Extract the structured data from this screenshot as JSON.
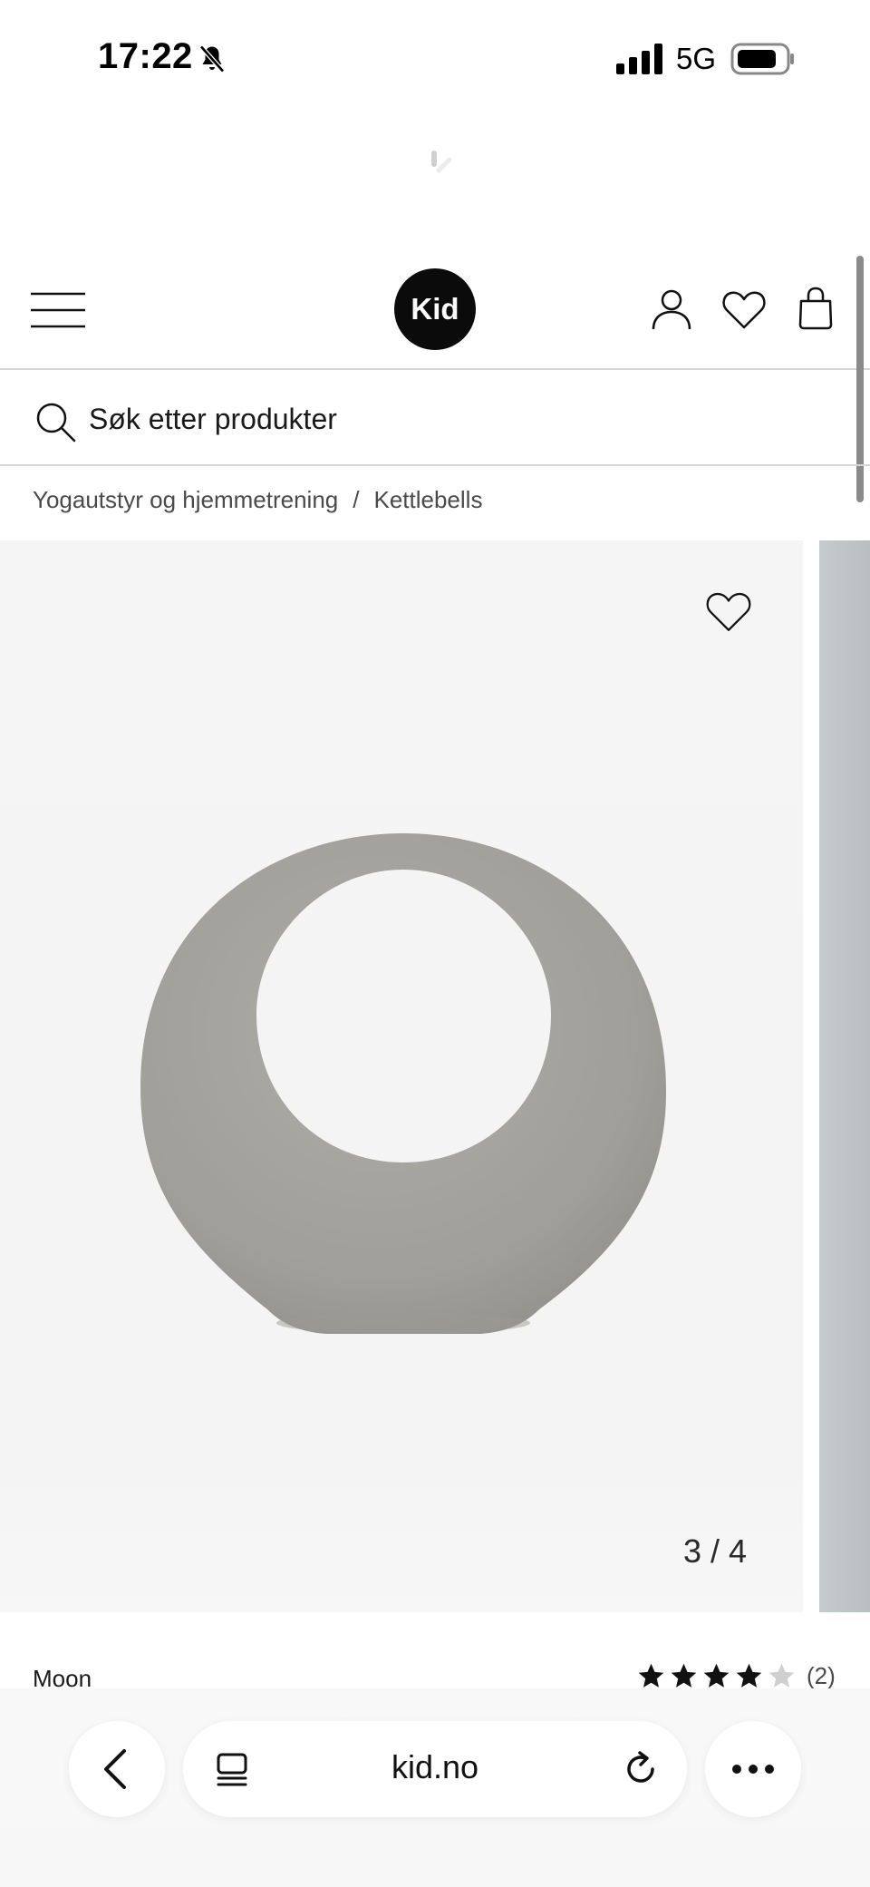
{
  "status_bar": {
    "time": "17:22",
    "network": "5G",
    "icons": [
      "bell-slash-icon",
      "signal-icon",
      "battery-icon"
    ]
  },
  "header": {
    "logo_text": "Kid",
    "icons": [
      "menu-icon",
      "account-icon",
      "heart-icon",
      "shopping-bag-icon"
    ]
  },
  "search": {
    "placeholder": "Søk etter produkter",
    "icon": "search-icon"
  },
  "breadcrumb": {
    "items": [
      "Yogautstyr og hjemmetrening",
      "Kettlebells"
    ],
    "separator": "/"
  },
  "gallery": {
    "counter": "3 / 4",
    "current": 3,
    "total": 4,
    "image_description": "grey moon-shaped kettlebell",
    "favorite_icon": "heart-icon"
  },
  "product": {
    "name": "Moon",
    "rating": 4,
    "rating_max": 5,
    "review_count": "(2)"
  },
  "browser": {
    "url": "kid.no",
    "icons": [
      "chevron-left-icon",
      "tabs-icon",
      "reload-icon",
      "more-icon"
    ]
  },
  "colors": {
    "logo_bg": "#0b0b0b",
    "divider": "#d6d6d6",
    "star_filled": "#111111",
    "star_empty": "#cfcfcf",
    "product_grey": "#a4a39e"
  }
}
